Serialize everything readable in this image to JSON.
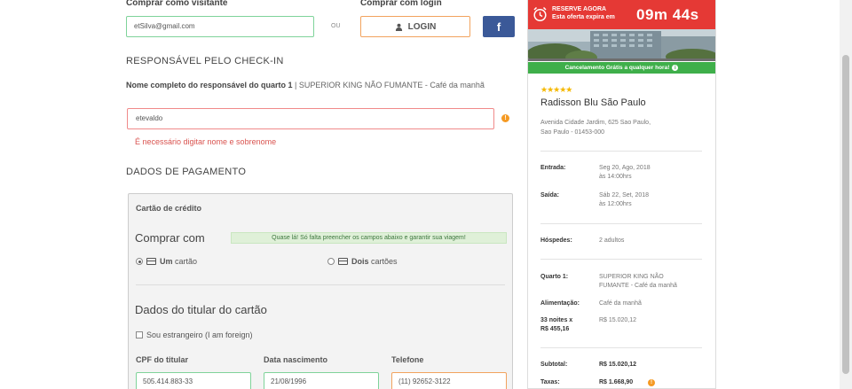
{
  "login": {
    "guest_label": "Comprar como visitante",
    "email_value": "etSilva@gmail.com",
    "or_label": "OU",
    "login_label_top": "Comprar com login",
    "login_button": "LOGIN",
    "facebook_letter": "f"
  },
  "checkin": {
    "title": "RESPONSÁVEL PELO CHECK-IN",
    "desc_bold": "Nome completo do responsável do quarto 1",
    "desc_rest": " | SUPERIOR KING NÃO FUMANTE - Café da manhã",
    "name_value": "etevaldo",
    "warn_symbol": "!",
    "error": "É necessário digitar nome e sobrenome"
  },
  "payment": {
    "title": "DADOS DE PAGAMENTO",
    "box_title": "Cartão de crédito",
    "comprar_com": "Comprar com",
    "note": "Quase lá! Só falta preencher os campos abaixo e garantir sua viagem!",
    "option_one_bold": "Um",
    "option_one_rest": " cartão",
    "option_two_bold": "Dois",
    "option_two_rest": " cartões",
    "holder_title": "Dados do titular do cartão",
    "foreign_label": "Sou estrangeiro (I am foreign)",
    "cpf_label": "CPF do titular",
    "cpf_value": "505.414.883-33",
    "birth_label": "Data nascimento",
    "birth_value": "21/08/1996",
    "phone_label": "Telefone",
    "phone_value": "(11) 92652-3122"
  },
  "summary": {
    "timer_line1": "RESERVE AGORA",
    "timer_line2": "Esta oferta expira em",
    "timer_value": "09m 44s",
    "cancel_text": "Cancelamento Grátis a qualquer hora!",
    "info_symbol": "i",
    "stars": "★★★★★",
    "hotel_name": "Radisson Blu São Paulo",
    "address_1": "Avenida Cidade Jardim, 625 Sao Paulo,",
    "address_2": "Sao Paulo - 01453-000",
    "checkin_label": "Entrada:",
    "checkin_date": "Seg 20, Ago, 2018",
    "checkin_time": "às 14:00hrs",
    "checkout_label": "Saída:",
    "checkout_date": "Sáb 22, Set, 2018",
    "checkout_time": "às 12:00hrs",
    "guests_label": "Hóspedes:",
    "guests_value": "2 adultos",
    "room_label": "Quarto 1:",
    "room_value_1": "SUPERIOR KING NÃO",
    "room_value_2": "FUMANTE - Café da manhã",
    "meal_label": "Alimentação:",
    "meal_value": "Café da manhã",
    "nights_label_1": "33 noites x",
    "nights_label_2": "R$ 455,16",
    "nights_value": "R$ 15.020,12",
    "subtotal_label": "Subtotal:",
    "subtotal_value": "R$ 15.020,12",
    "taxes_label": "Taxas:",
    "taxes_value": "R$ 1.668,90"
  },
  "colors": {
    "timer_red": "#e53935",
    "cancel_green": "#3faf4a",
    "facebook_blue": "#3b5998",
    "error_red": "#d9534f",
    "warning_orange": "#f59a23"
  }
}
